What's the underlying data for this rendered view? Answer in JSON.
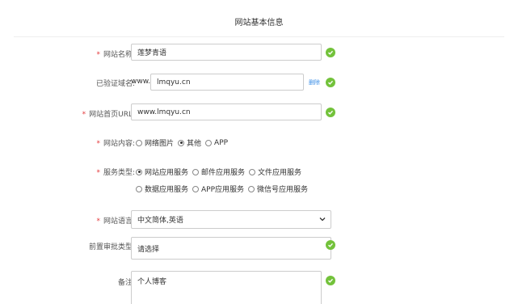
{
  "page_title": "网站基本信息",
  "fields": {
    "site_name": {
      "label": "网站名称:",
      "value": "莲梦青语"
    },
    "verified_domain": {
      "label": "已验证域名:",
      "prefix": "www.",
      "value": "lmqyu.cn",
      "delete_label": "删除"
    },
    "homepage_url": {
      "label": "网站首页URL:",
      "value": "www.lmqyu.cn"
    },
    "site_content": {
      "label": "网站内容:",
      "options": [
        {
          "label": "网络图片",
          "selected": false
        },
        {
          "label": "其他",
          "selected": true
        },
        {
          "label": "APP",
          "selected": false
        }
      ]
    },
    "service_type": {
      "label": "服务类型:",
      "options": [
        {
          "label": "网站应用服务",
          "selected": true
        },
        {
          "label": "邮件应用服务",
          "selected": false
        },
        {
          "label": "文件应用服务",
          "selected": false
        },
        {
          "label": "数据应用服务",
          "selected": false
        },
        {
          "label": "APP应用服务",
          "selected": false
        },
        {
          "label": "微信号应用服务",
          "selected": false
        }
      ]
    },
    "site_language": {
      "label": "网站语言:",
      "value": "中文简体,英语"
    },
    "pre_approval_type": {
      "label": "前置审批类型:",
      "placeholder": "请选择"
    },
    "remarks": {
      "label": "备注:",
      "value": "个人博客"
    }
  },
  "required_mark": "*",
  "colors": {
    "check_green": "#73c23b",
    "required_red": "#e4393c",
    "link_blue": "#3a8ee6"
  }
}
